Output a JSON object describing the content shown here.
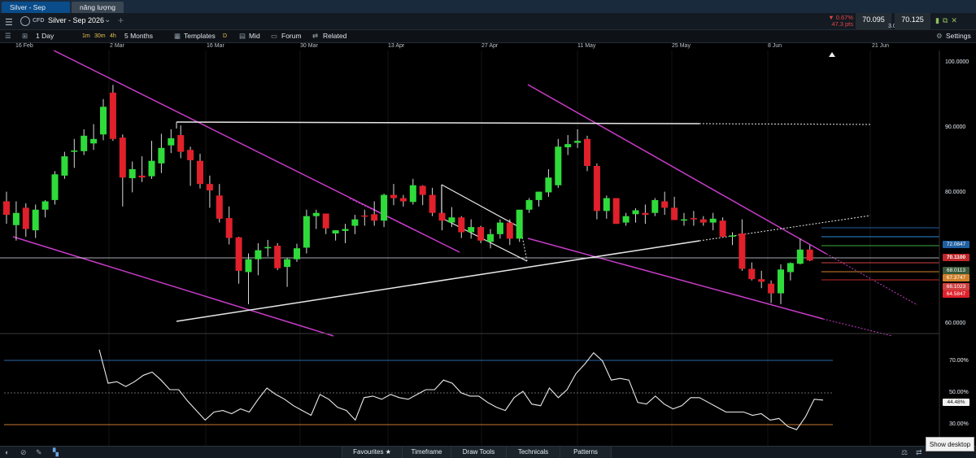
{
  "tabs": [
    "Silver - Sep 2026",
    "năng lượng"
  ],
  "header": {
    "menu_icon": "hamburger-icon",
    "product_type": "CFD",
    "title": "Silver - Sep 2026",
    "change_pct": "▼ 0.67%",
    "change_pts": "47.3 pts",
    "sell_price": "70.095",
    "spread": "3.0",
    "buy_price": "70.125",
    "status_color": "#8fbf60"
  },
  "toolbar": {
    "interval": "1 Day",
    "timeframes": [
      "1m",
      "30m",
      "4h"
    ],
    "range": "5 Months",
    "templates": "Templates",
    "d_label": "D",
    "mid": "Mid",
    "forum": "Forum",
    "related": "Related",
    "settings": "Settings"
  },
  "dates": [
    "16 Feb",
    "2 Mar",
    "16 Mar",
    "30 Mar",
    "13 Apr",
    "27 Apr",
    "11 May",
    "25 May",
    "8 Jun",
    "21 Jun"
  ],
  "price_axis": [
    "100.0000",
    "90.0000",
    "80.0000",
    "60.0000"
  ],
  "price_tags": {
    "upper": "72.0847",
    "current": "70.1100",
    "t1": "68.0113",
    "t2": "67.3747",
    "t3": "66.1023",
    "t4": "64.5847"
  },
  "rsi_axis": [
    "70.00%",
    "50.00%",
    "30.00%"
  ],
  "rsi_value": "44.48%",
  "bottom": {
    "favourites": "Favourites",
    "timeframe": "Timeframe",
    "draw_tools": "Draw Tools",
    "technicals": "Technicals",
    "patterns": "Patterns"
  },
  "show_desktop": "Show desktop",
  "colors": {
    "up": "#2edb3a",
    "down": "#e0202b",
    "trend": "#c83cc8",
    "accent": "#0a4d8a"
  },
  "chart_data": {
    "type": "candlestick",
    "title": "",
    "candles": [
      [
        79.3,
        80.8,
        75.8,
        77.2
      ],
      [
        75.6,
        79.3,
        73.2,
        77.5
      ],
      [
        78.3,
        79.0,
        73.8,
        75.0
      ],
      [
        74.8,
        78.8,
        73.6,
        78.0
      ],
      [
        78.0,
        79.5,
        76.8,
        79.3
      ],
      [
        79.5,
        84.0,
        78.8,
        83.5
      ],
      [
        83.3,
        87.0,
        82.8,
        86.3
      ],
      [
        87.0,
        89.0,
        84.5,
        87.2
      ],
      [
        87.1,
        90.5,
        86.5,
        89.5
      ],
      [
        88.3,
        91.3,
        87.3,
        89.0
      ],
      [
        89.7,
        95.2,
        88.8,
        94.0
      ],
      [
        96.2,
        97.4,
        88.7,
        89.0
      ],
      [
        89.2,
        89.7,
        78.5,
        83.0
      ],
      [
        82.9,
        85.5,
        80.7,
        84.3
      ],
      [
        83.3,
        86.3,
        82.3,
        83.0
      ],
      [
        83.2,
        88.7,
        82.8,
        85.6
      ],
      [
        85.2,
        89.8,
        83.7,
        87.6
      ],
      [
        88.0,
        90.5,
        86.8,
        89.1
      ],
      [
        89.6,
        91.1,
        86.0,
        87.0
      ],
      [
        87.3,
        87.8,
        81.7,
        85.7
      ],
      [
        85.6,
        86.7,
        81.3,
        82.0
      ],
      [
        82.0,
        83.3,
        78.3,
        81.0
      ],
      [
        80.2,
        82.0,
        76.0,
        76.6
      ],
      [
        76.7,
        78.5,
        72.6,
        73.6
      ],
      [
        73.7,
        73.8,
        66.5,
        68.5
      ],
      [
        68.3,
        71.2,
        63.3,
        70.3
      ],
      [
        70.3,
        72.8,
        67.8,
        71.7
      ],
      [
        72.0,
        73.3,
        70.7,
        72.2
      ],
      [
        72.4,
        72.8,
        68.6,
        68.9
      ],
      [
        69.1,
        70.5,
        66.0,
        70.3
      ],
      [
        70.3,
        72.7,
        69.9,
        72.0
      ],
      [
        72.1,
        78.0,
        71.2,
        77.0
      ],
      [
        77.0,
        78.0,
        75.0,
        77.5
      ],
      [
        77.4,
        76.3,
        74.2,
        75.1
      ],
      [
        74.3,
        74.8,
        73.2,
        74.8
      ],
      [
        74.7,
        75.8,
        72.8,
        75.0
      ],
      [
        75.5,
        77.2,
        74.2,
        76.5
      ],
      [
        77.1,
        78.0,
        75.5,
        77.0
      ],
      [
        77.3,
        79.3,
        75.5,
        76.3
      ],
      [
        76.3,
        80.5,
        75.3,
        80.3
      ],
      [
        80.3,
        82.0,
        78.7,
        79.8
      ],
      [
        79.8,
        80.3,
        78.5,
        79.3
      ],
      [
        79.2,
        82.8,
        78.8,
        81.8
      ],
      [
        81.7,
        81.8,
        78.7,
        80.3
      ],
      [
        80.3,
        81.4,
        77.0,
        77.5
      ],
      [
        77.5,
        77.6,
        74.8,
        76.3
      ],
      [
        76.0,
        78.4,
        75.3,
        76.8
      ],
      [
        76.8,
        77.0,
        73.6,
        74.5
      ],
      [
        74.5,
        76.5,
        73.5,
        75.3
      ],
      [
        75.3,
        75.5,
        72.8,
        73.2
      ],
      [
        73.0,
        75.0,
        72.0,
        74.2
      ],
      [
        74.2,
        76.5,
        73.5,
        76.0
      ],
      [
        76.0,
        76.5,
        72.5,
        73.5
      ],
      [
        73.5,
        78.0,
        73.0,
        78.0
      ],
      [
        78.0,
        79.8,
        77.5,
        79.5
      ],
      [
        79.5,
        80.5,
        78.5,
        80.8
      ],
      [
        80.7,
        84.3,
        80.0,
        83.0
      ],
      [
        81.8,
        89.0,
        81.4,
        87.8
      ],
      [
        87.7,
        89.6,
        86.5,
        88.2
      ],
      [
        88.4,
        90.5,
        87.6,
        88.7
      ],
      [
        89.0,
        89.5,
        84.0,
        84.8
      ],
      [
        84.8,
        85.2,
        76.5,
        77.8
      ],
      [
        77.8,
        80.2,
        76.6,
        79.8
      ],
      [
        79.8,
        79.0,
        75.8,
        75.8
      ],
      [
        76.0,
        77.5,
        75.5,
        77.0
      ],
      [
        77.3,
        78.2,
        76.0,
        77.9
      ],
      [
        77.5,
        78.8,
        75.8,
        77.2
      ],
      [
        77.5,
        79.8,
        77.0,
        79.5
      ],
      [
        79.3,
        80.8,
        77.2,
        78.3
      ],
      [
        78.3,
        80.0,
        76.8,
        76.4
      ],
      [
        76.5,
        77.5,
        75.5,
        76.5
      ],
      [
        76.7,
        77.8,
        75.5,
        76.5
      ],
      [
        76.5,
        77.0,
        75.5,
        76.0
      ],
      [
        76.0,
        77.5,
        74.8,
        76.6
      ],
      [
        76.3,
        76.8,
        75.0,
        73.8
      ],
      [
        73.8,
        74.5,
        72.5,
        74.0
      ],
      [
        74.3,
        76.5,
        68.5,
        68.8
      ],
      [
        68.8,
        69.8,
        67.0,
        67.2
      ],
      [
        67.2,
        68.5,
        65.8,
        66.8
      ],
      [
        66.5,
        67.0,
        63.5,
        65.0
      ],
      [
        65.0,
        69.5,
        63.3,
        68.7
      ],
      [
        68.3,
        69.8,
        67.0,
        69.7
      ],
      [
        69.6,
        73.5,
        69.5,
        71.8
      ],
      [
        71.8,
        72.5,
        70.0,
        70.1
      ]
    ],
    "rsi": [
      76,
      55,
      56,
      53,
      56,
      60,
      62,
      57,
      51,
      51,
      44,
      38,
      32,
      37,
      38,
      36,
      39,
      37,
      45,
      52,
      48,
      45,
      41,
      38,
      35,
      48,
      45,
      40,
      38,
      32,
      46,
      47,
      45,
      48,
      46,
      45,
      48,
      51,
      51,
      57,
      55,
      49,
      47,
      47,
      43,
      40,
      38,
      46,
      50,
      42,
      41,
      52,
      46,
      51,
      61,
      67,
      74,
      69,
      57,
      58,
      57,
      43,
      42,
      47,
      42,
      39,
      41,
      46,
      46,
      43,
      40,
      37,
      37,
      37,
      35,
      36,
      32,
      33,
      28,
      26,
      34,
      45,
      44.48
    ],
    "y_range": [
      59,
      102
    ],
    "rsi_range": [
      20,
      82
    ]
  }
}
